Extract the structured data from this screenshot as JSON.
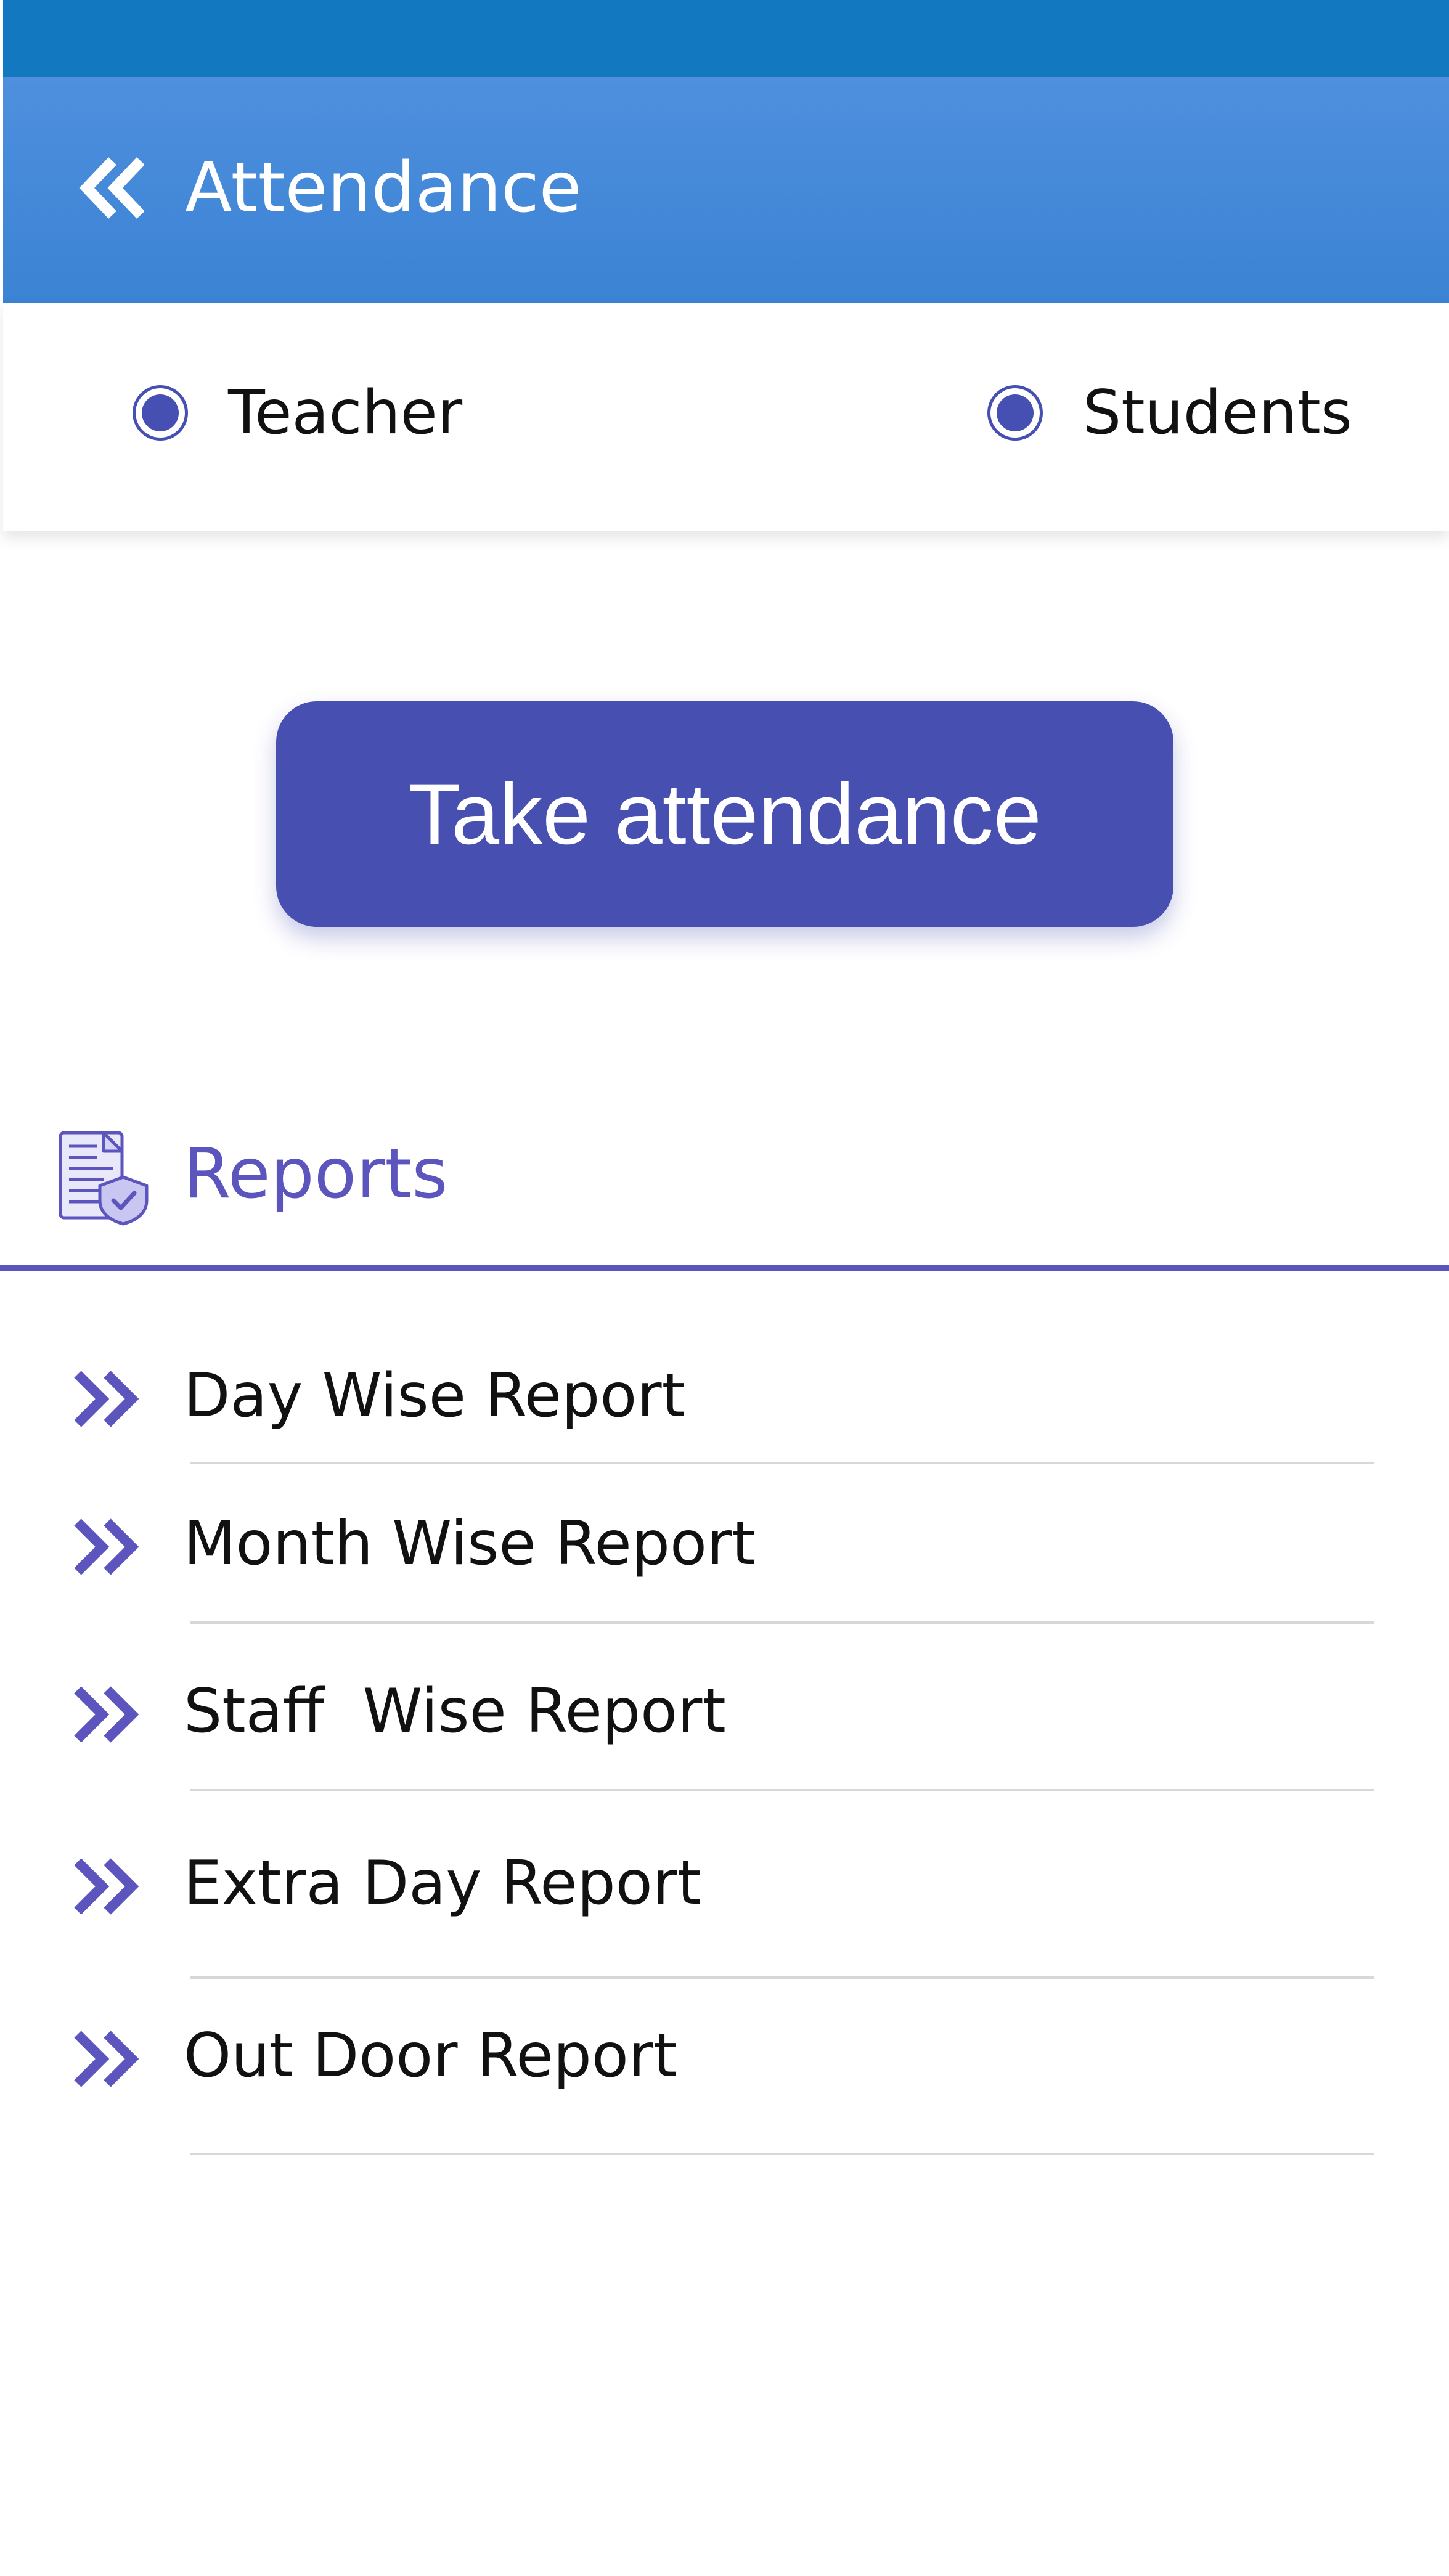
{
  "header": {
    "title": "Attendance",
    "back_icon": "double-chevron-left-icon"
  },
  "colors": {
    "status_bar": "#1278bf",
    "header": "#3b83d4",
    "accent": "#4750b0",
    "reports_accent": "#5b55bd"
  },
  "selector": {
    "options": [
      {
        "label": "Teacher",
        "selected": true
      },
      {
        "label": "Students",
        "selected": true
      }
    ]
  },
  "actions": {
    "take_attendance_label": "Take attendance"
  },
  "reports": {
    "title": "Reports",
    "icon": "secure-document-icon",
    "items": [
      {
        "label": "Day Wise Report",
        "icon": "double-chevron-right-icon"
      },
      {
        "label": "Month Wise Report",
        "icon": "double-chevron-right-icon"
      },
      {
        "label": "Staff  Wise Report",
        "icon": "double-chevron-right-icon"
      },
      {
        "label": "Extra Day Report",
        "icon": "double-chevron-right-icon"
      },
      {
        "label": "Out Door Report",
        "icon": "double-chevron-right-icon"
      }
    ]
  }
}
